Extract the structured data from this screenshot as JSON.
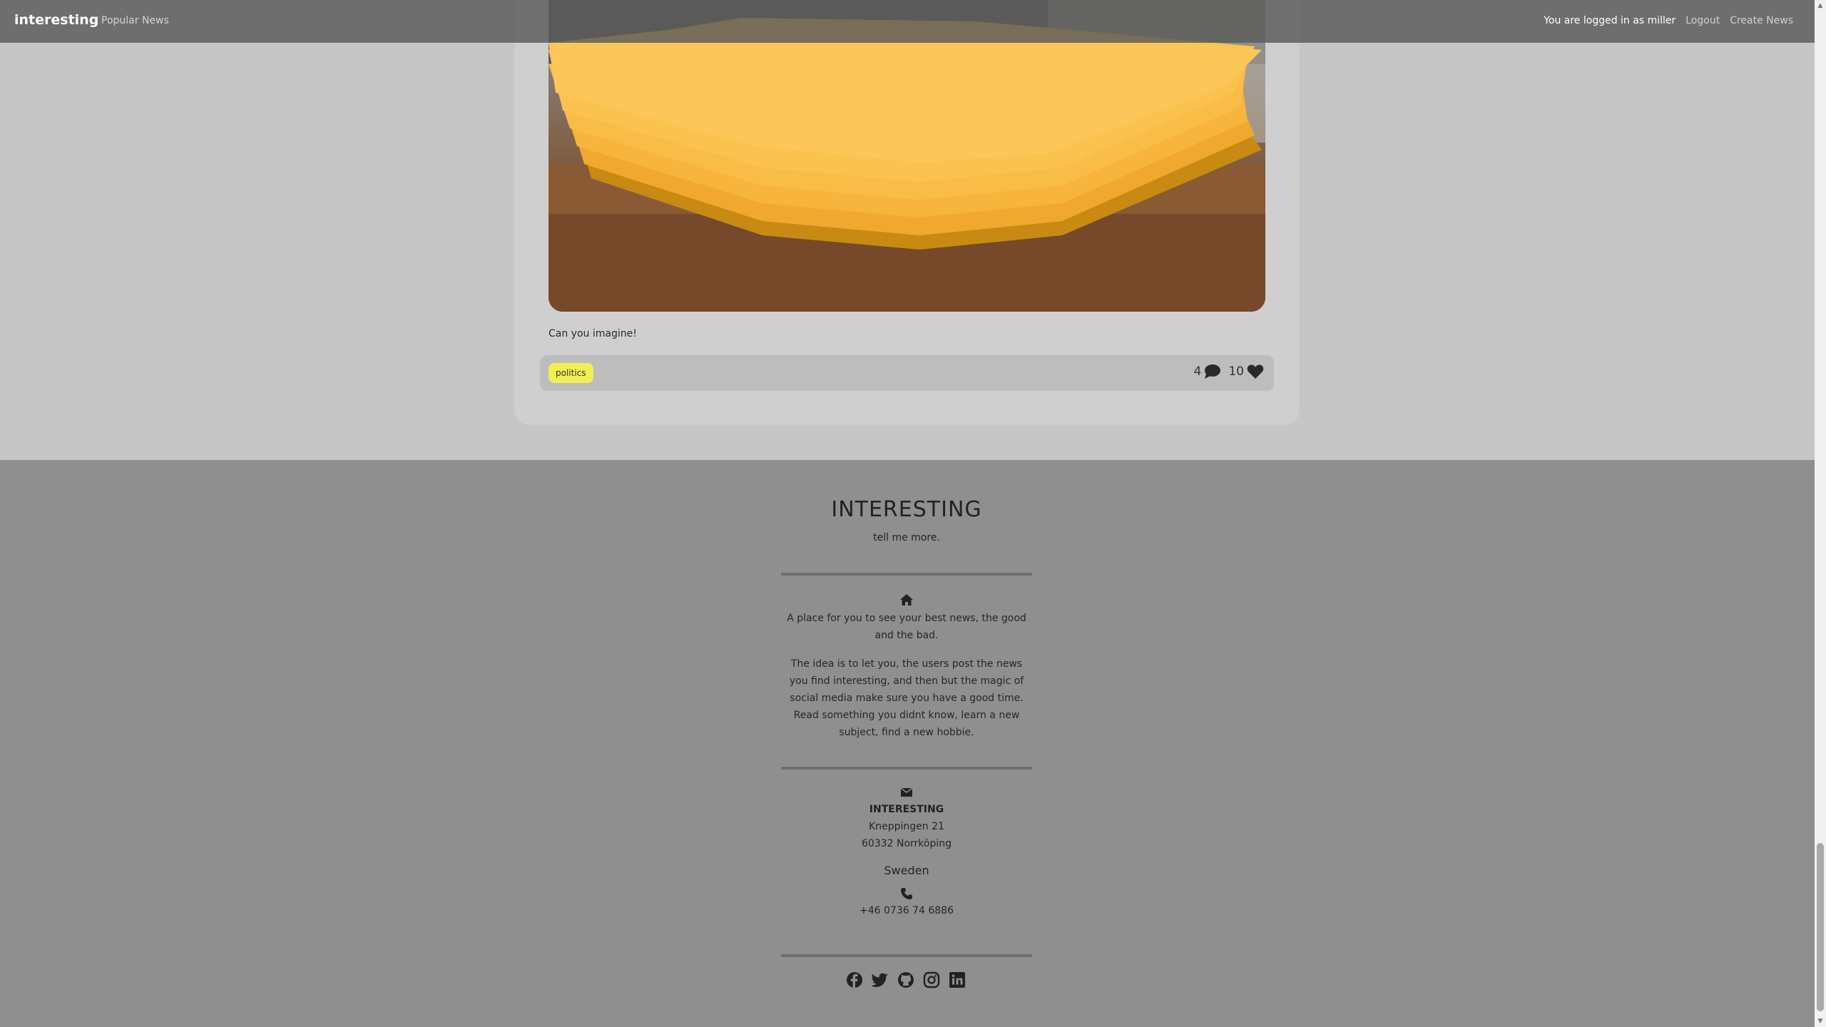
{
  "nav": {
    "brand": "interesting",
    "popular": "Popular News",
    "user_status": "You are logged in as miller",
    "logout": "Logout",
    "create": "Create News"
  },
  "article": {
    "description": "Can you imagine!",
    "tag": "politics",
    "comments": "4",
    "likes": "10"
  },
  "footer": {
    "title": "INTERESTING",
    "subtitle": "tell me more.",
    "about_1": "A place for you to see your best news, the good and the bad.",
    "about_2": "The idea is to let you, the users post the news you find interesting, and then but the magic of social media make sure you have a good time. Read something you didnt know, learn a new subject, find a new hobbie.",
    "company": "INTERESTING",
    "street": "Kneppingen 21",
    "city": "60332 Norrköping",
    "country": "Sweden",
    "phone": "+46 0736 74 6886"
  },
  "icons": [
    "home-icon",
    "envelope-icon",
    "phone-icon",
    "facebook-icon",
    "twitter-icon",
    "github-icon",
    "instagram-icon",
    "linkedin-icon",
    "comment-icon",
    "heart-icon"
  ],
  "colors": {
    "tag_bg": "#f2ef55",
    "footer_bg": "#8f8f8f",
    "content_bg": "#c6c6c6"
  }
}
